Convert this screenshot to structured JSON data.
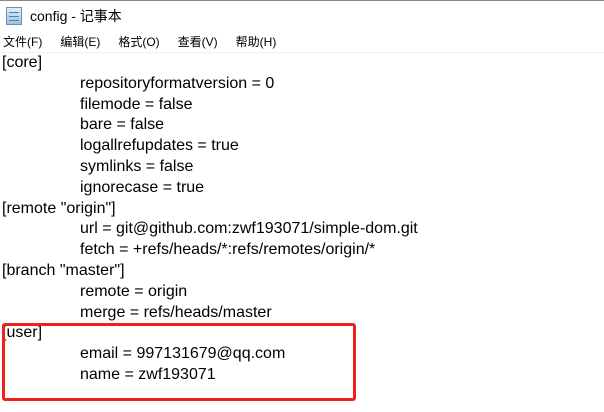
{
  "window": {
    "title": "config - 记事本"
  },
  "menu": [
    "文件(F)",
    "编辑(E)",
    "格式(O)",
    "查看(V)",
    "帮助(H)"
  ],
  "lines": [
    {
      "text": "[core]",
      "indent": false
    },
    {
      "text": "repositoryformatversion = 0",
      "indent": true
    },
    {
      "text": "filemode = false",
      "indent": true
    },
    {
      "text": "bare = false",
      "indent": true
    },
    {
      "text": "logallrefupdates = true",
      "indent": true
    },
    {
      "text": "symlinks = false",
      "indent": true
    },
    {
      "text": "ignorecase = true",
      "indent": true
    },
    {
      "text": "[remote \"origin\"]",
      "indent": false
    },
    {
      "text": "url = git@github.com:zwf193071/simple-dom.git",
      "indent": true
    },
    {
      "text": "fetch = +refs/heads/*:refs/remotes/origin/*",
      "indent": true
    },
    {
      "text": "[branch \"master\"]",
      "indent": false
    },
    {
      "text": "remote = origin",
      "indent": true
    },
    {
      "text": "merge = refs/heads/master",
      "indent": true
    },
    {
      "text": "[user]",
      "indent": false
    },
    {
      "text": "email = 997131679@qq.com",
      "indent": true
    },
    {
      "text": "name = zwf193071",
      "indent": true
    }
  ],
  "highlight_color": "#f0201c"
}
